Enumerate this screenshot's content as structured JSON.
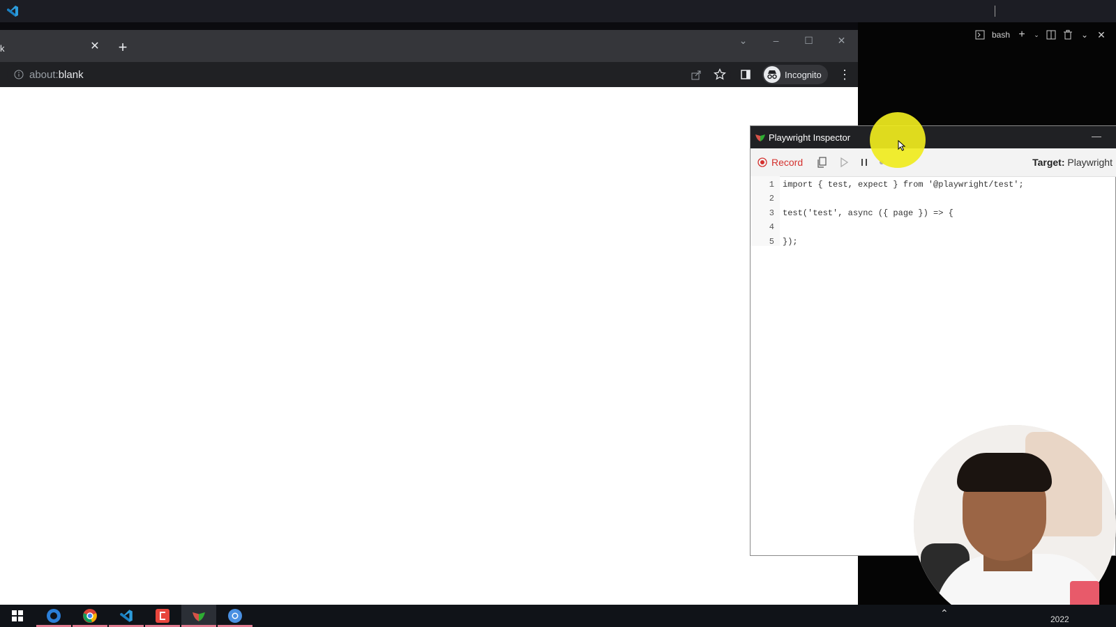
{
  "chrome": {
    "tab_title": "k",
    "address_scheme": "about:",
    "address_host": "blank",
    "profile_label": "Incognito"
  },
  "terminal": {
    "shell_label": "bash"
  },
  "inspector": {
    "title": "Playwright Inspector",
    "record_label": "Record",
    "target_label": "Target:",
    "target_value": "Playwright",
    "code": [
      {
        "num": "1",
        "text": "import { test, expect } from '@playwright/test';"
      },
      {
        "num": "2",
        "text": ""
      },
      {
        "num": "3",
        "text": "test('test', async ({ page }) => {"
      },
      {
        "num": "4",
        "text": ""
      },
      {
        "num": "5",
        "text": "});"
      }
    ]
  },
  "taskbar": {
    "clock_year": "2022",
    "apps": [
      "windows-start",
      "app-blue-circle",
      "chrome",
      "vscode",
      "red-app",
      "playwright",
      "chrome-alt"
    ]
  },
  "colors": {
    "record_red": "#d4312e",
    "cursor_highlight": "#f0eb1e",
    "chrome_dark": "#202124"
  }
}
